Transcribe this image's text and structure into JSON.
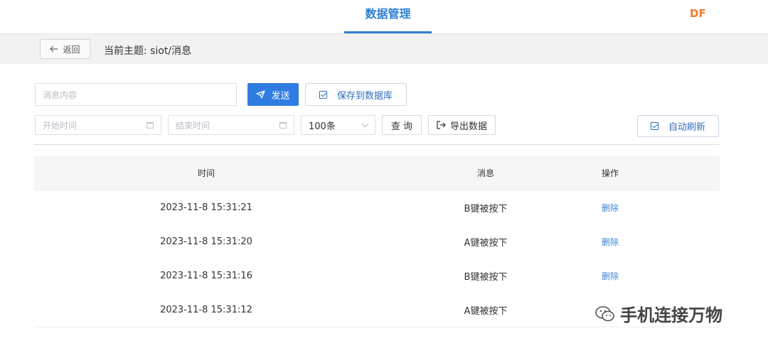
{
  "nav": {
    "active_tab": "数据管理",
    "brand": "DF"
  },
  "subbar": {
    "back_label": "返回",
    "topic": "当前主题: siot/消息"
  },
  "form": {
    "message_placeholder": "消息内容",
    "send_label": "发送",
    "save_db_label": "保存到数据库",
    "start_time_placeholder": "开始时间",
    "end_time_placeholder": "结束时间",
    "count_selected": "100条",
    "query_label": "查 询",
    "export_label": "导出数据",
    "auto_refresh_label": "自动刷新"
  },
  "table": {
    "headers": [
      "时间",
      "消息",
      "操作"
    ],
    "rows": [
      {
        "time": "2023-11-8 15:31:21",
        "message": "B键被按下",
        "action": "删除"
      },
      {
        "time": "2023-11-8 15:31:20",
        "message": "A键被按下",
        "action": "删除"
      },
      {
        "time": "2023-11-8 15:31:16",
        "message": "B键被按下",
        "action": "删除"
      },
      {
        "time": "2023-11-8 15:31:12",
        "message": "A键被按下",
        "action": ""
      }
    ]
  },
  "watermark": {
    "text": "手机连接万物"
  },
  "colors": {
    "accent": "#2f7de1",
    "brand": "#f07a2a",
    "link": "#3d86d6"
  }
}
